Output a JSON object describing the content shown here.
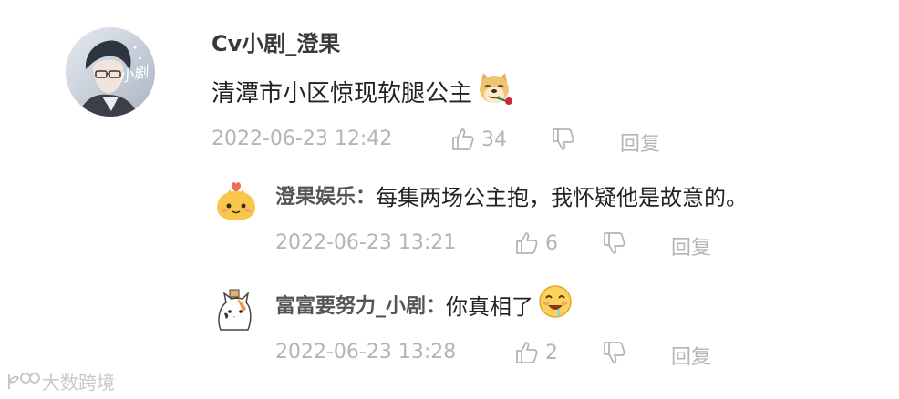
{
  "comment": {
    "username": "Cv小剧_澄果",
    "text": "清潭市小区惊现软腿公主",
    "emoji": "doge-rose-icon",
    "avatar_text": "小剧",
    "timestamp": "2022-06-23 12:42",
    "likes": "34",
    "reply_label": "回复"
  },
  "replies": [
    {
      "username": "澄果娱乐",
      "separator": "：",
      "text": "每集两场公主抱，我怀疑他是故意的。",
      "timestamp": "2022-06-23 13:21",
      "likes": "6",
      "reply_label": "回复"
    },
    {
      "username": "富富要努力_小剧",
      "separator": "：",
      "text": "你真相了",
      "emoji": "drooling-face-icon",
      "timestamp": "2022-06-23 13:28",
      "likes": "2",
      "reply_label": "回复"
    }
  ],
  "watermark": {
    "text": "大数跨境"
  },
  "colors": {
    "meta_gray": "#b4b4b4",
    "name_gray": "#555555",
    "text_dark": "#222222"
  }
}
